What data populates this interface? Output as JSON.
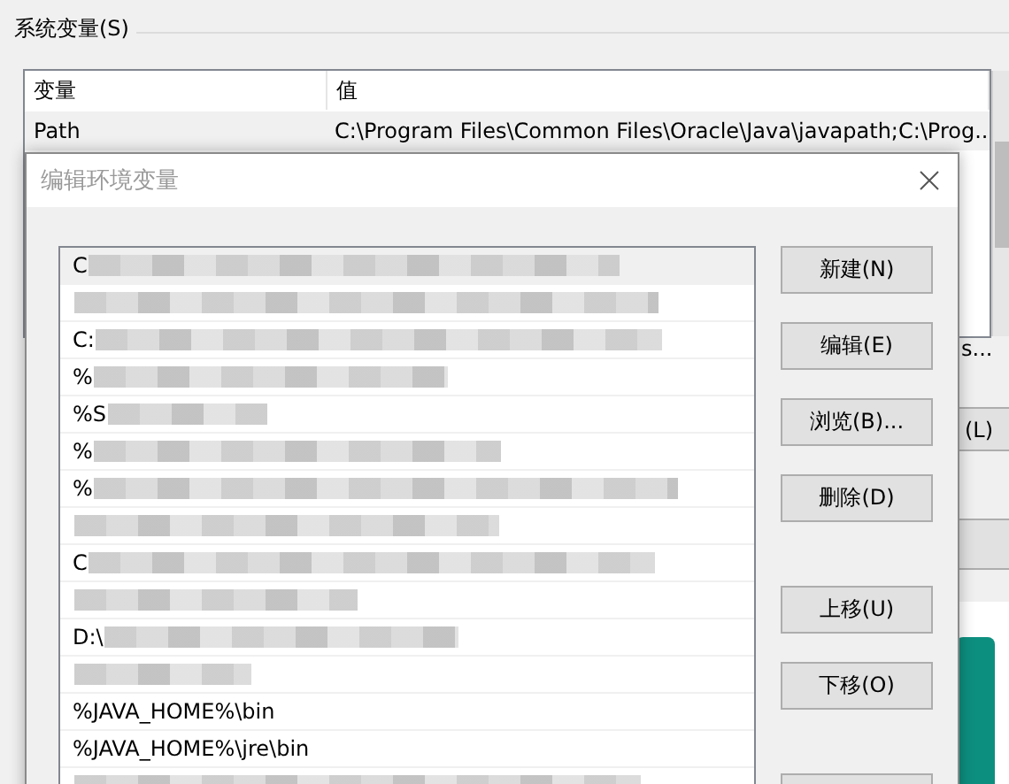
{
  "back_window": {
    "group_label": "系统变量(S)",
    "columns": [
      "变量",
      "值"
    ],
    "rows": [
      {
        "variable": "Path",
        "value": "C:\\Program Files\\Common Files\\Oracle\\Java\\javapath;C:\\Prog...",
        "selected": true
      }
    ],
    "peek_texts": [
      "s...",
      "(L)"
    ]
  },
  "dialog": {
    "title": "编辑环境变量",
    "entries": [
      {
        "text": "C",
        "redacted": true,
        "selected": true
      },
      {
        "redacted": true,
        "selected": false
      },
      {
        "text": "C:",
        "redacted": true,
        "selected": false
      },
      {
        "text": "%",
        "redacted": true,
        "selected": false
      },
      {
        "text": "%S",
        "redacted": true,
        "selected": false
      },
      {
        "text": "%",
        "redacted": true,
        "selected": false
      },
      {
        "text": "%",
        "redacted": true,
        "selected": false
      },
      {
        "redacted": true,
        "selected": false
      },
      {
        "text": "C",
        "redacted": true,
        "selected": false
      },
      {
        "redacted": true,
        "selected": false
      },
      {
        "text": "D:\\",
        "redacted": true,
        "selected": false
      },
      {
        "redacted": true,
        "selected": false
      },
      {
        "text": "%JAVA_HOME%\\bin",
        "redacted": false,
        "selected": false
      },
      {
        "text": "%JAVA_HOME%\\jre\\bin",
        "redacted": false,
        "selected": false
      },
      {
        "redacted": true,
        "selected": false
      }
    ],
    "buttons": [
      "新建(N)",
      "编辑(E)",
      "浏览(B)...",
      "删除(D)"
    ],
    "move_buttons": [
      "上移(U)",
      "下移(O)"
    ]
  }
}
